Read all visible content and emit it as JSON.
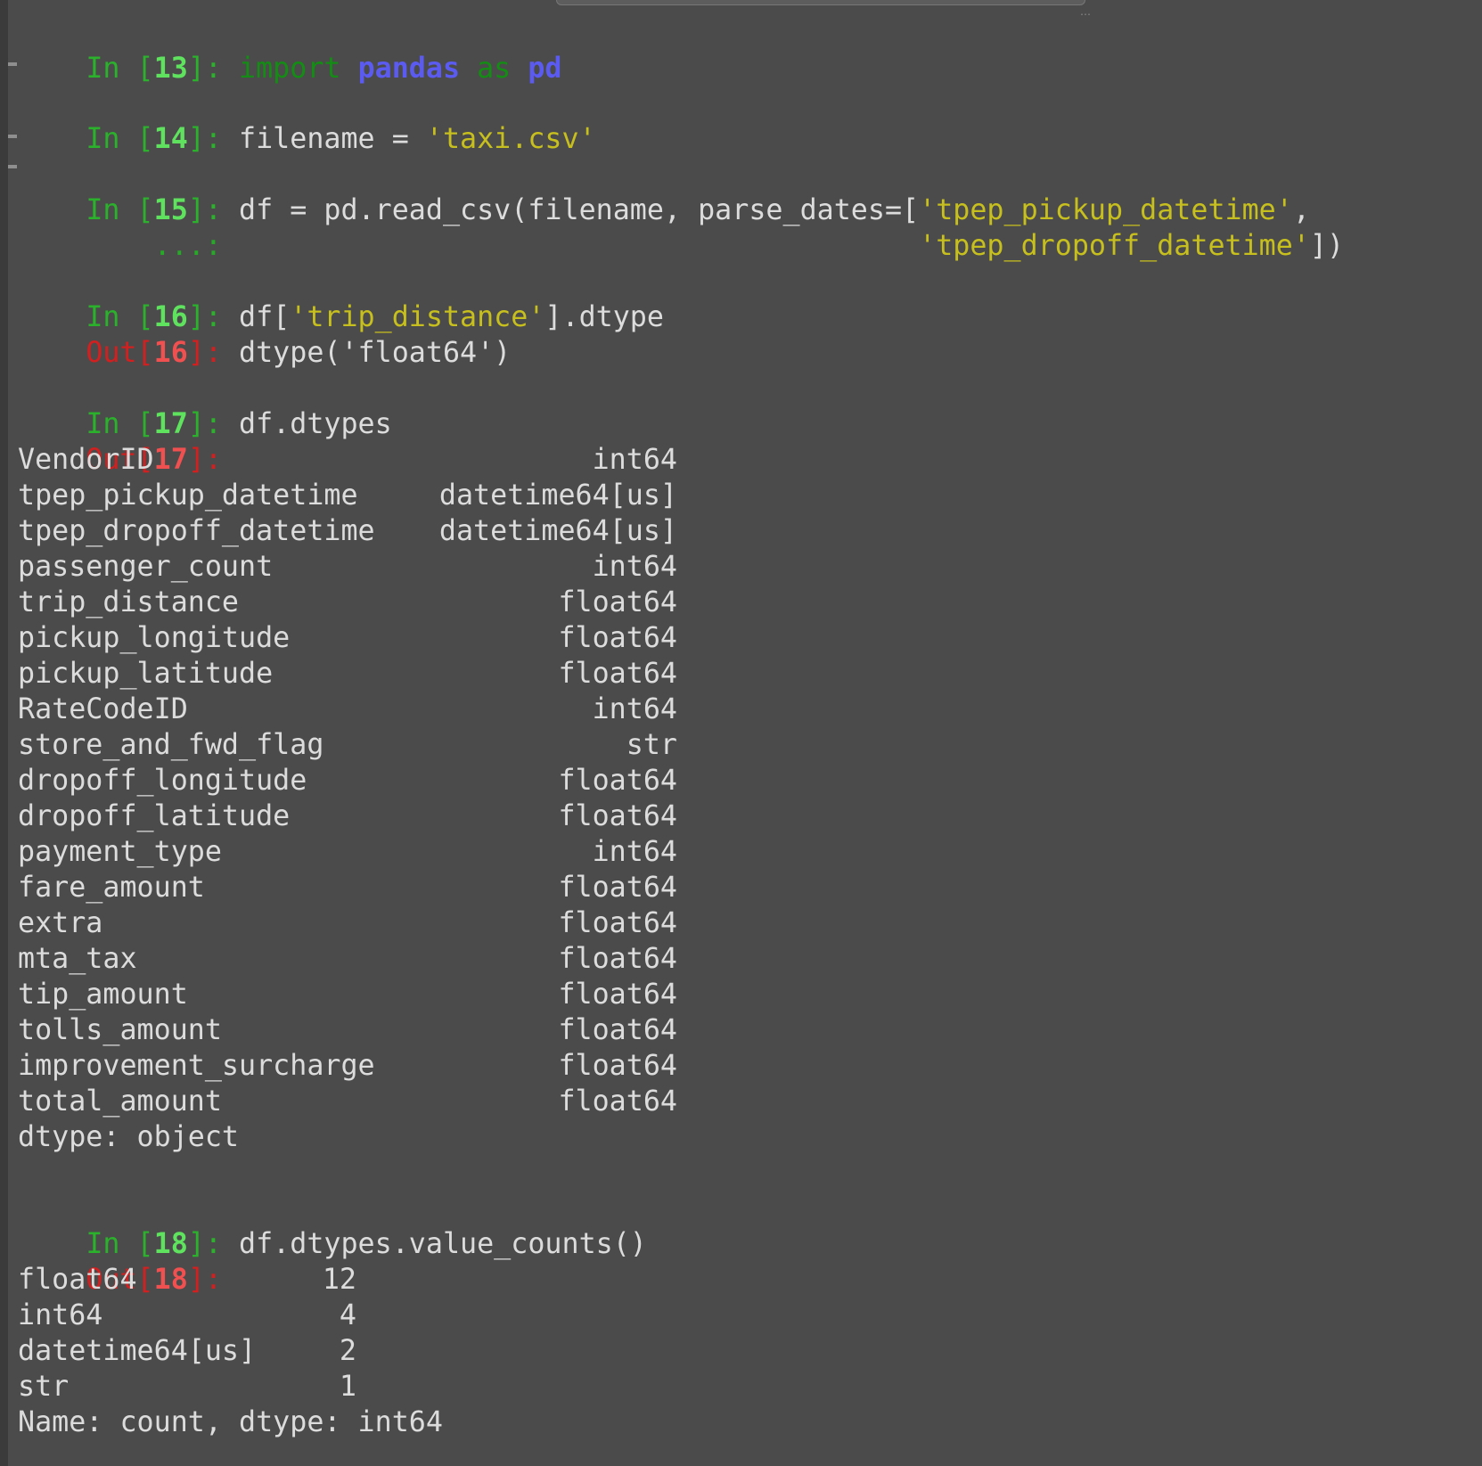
{
  "cells": {
    "c13": {
      "prompt": "In",
      "num": "13",
      "kw_import": "import",
      "mod_pandas": "pandas",
      "kw_as": "as",
      "mod_pd": "pd"
    },
    "c14": {
      "prompt": "In",
      "num": "14",
      "code": "filename = ",
      "str": "'taxi.csv'"
    },
    "c15": {
      "prompt": "In",
      "num": "15",
      "code": "df = pd.read_csv(filename, parse_dates=[",
      "str1": "'tpep_pickup_datetime'",
      "code_end1": ",",
      "cont": "...:",
      "str2": "'tpep_dropoff_datetime'",
      "code_end2": "])"
    },
    "c16": {
      "prompt": "In",
      "num": "16",
      "code_a": "df[",
      "str": "'trip_distance'",
      "code_b": "].dtype",
      "out_prompt": "Out",
      "out": "dtype('float64')"
    },
    "c17": {
      "prompt": "In",
      "num": "17",
      "code": "df.dtypes",
      "out_prompt": "Out",
      "footer": "dtype: object"
    },
    "c18": {
      "prompt": "In",
      "num": "18",
      "code": "df.dtypes.value_counts()",
      "out_prompt": "Out",
      "footer": "Name: count, dtype: int64"
    }
  },
  "dtypes_table": [
    {
      "name": "VendorID",
      "dtype": "int64"
    },
    {
      "name": "tpep_pickup_datetime",
      "dtype": "datetime64[us]"
    },
    {
      "name": "tpep_dropoff_datetime",
      "dtype": "datetime64[us]"
    },
    {
      "name": "passenger_count",
      "dtype": "int64"
    },
    {
      "name": "trip_distance",
      "dtype": "float64"
    },
    {
      "name": "pickup_longitude",
      "dtype": "float64"
    },
    {
      "name": "pickup_latitude",
      "dtype": "float64"
    },
    {
      "name": "RateCodeID",
      "dtype": "int64"
    },
    {
      "name": "store_and_fwd_flag",
      "dtype": "str"
    },
    {
      "name": "dropoff_longitude",
      "dtype": "float64"
    },
    {
      "name": "dropoff_latitude",
      "dtype": "float64"
    },
    {
      "name": "payment_type",
      "dtype": "int64"
    },
    {
      "name": "fare_amount",
      "dtype": "float64"
    },
    {
      "name": "extra",
      "dtype": "float64"
    },
    {
      "name": "mta_tax",
      "dtype": "float64"
    },
    {
      "name": "tip_amount",
      "dtype": "float64"
    },
    {
      "name": "tolls_amount",
      "dtype": "float64"
    },
    {
      "name": "improvement_surcharge",
      "dtype": "float64"
    },
    {
      "name": "total_amount",
      "dtype": "float64"
    }
  ],
  "value_counts": [
    {
      "dtype": "float64",
      "count": "12"
    },
    {
      "dtype": "int64",
      "count": "4"
    },
    {
      "dtype": "datetime64[us]",
      "count": "2"
    },
    {
      "dtype": "str",
      "count": "1"
    }
  ],
  "scroll_dots": "…"
}
